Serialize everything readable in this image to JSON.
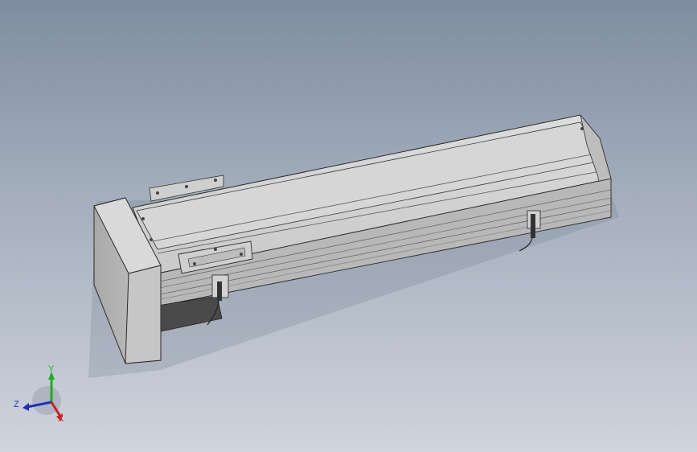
{
  "viewport": {
    "background_top": "#7f8da0",
    "background_bottom": "#cfd4dd"
  },
  "model": {
    "description_icon": "linear-actuator-model"
  },
  "triad": {
    "y_label": "Y",
    "z_label": "Z",
    "x_label": "X",
    "y_color": "#22aa22",
    "z_color": "#1f2fb8",
    "x_color": "#cc2222"
  }
}
